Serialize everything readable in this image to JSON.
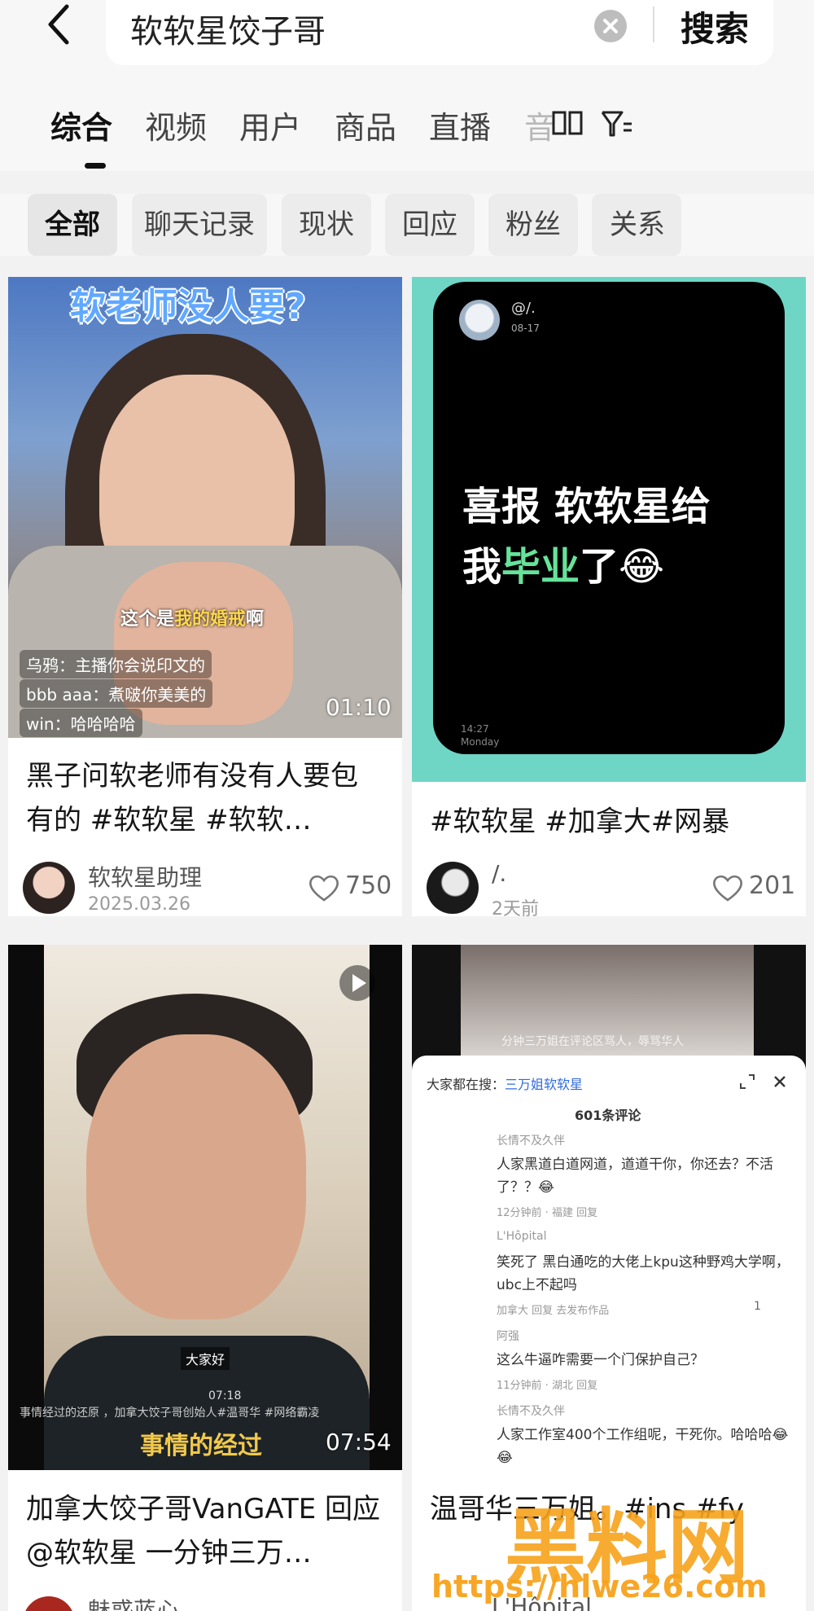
{
  "search": {
    "query": "软软星饺子哥",
    "button": "搜索"
  },
  "tabs": [
    {
      "label": "综合",
      "active": true
    },
    {
      "label": "视频",
      "active": false
    },
    {
      "label": "用户",
      "active": false
    },
    {
      "label": "商品",
      "active": false
    },
    {
      "label": "直播",
      "active": false
    },
    {
      "label": "音",
      "active": false
    }
  ],
  "chips": [
    {
      "label": "全部",
      "active": true
    },
    {
      "label": "聊天记录",
      "active": false
    },
    {
      "label": "现状",
      "active": false
    },
    {
      "label": "回应",
      "active": false
    },
    {
      "label": "粉丝",
      "active": false
    },
    {
      "label": "关系",
      "active": false
    }
  ],
  "cards": [
    {
      "thumb_caption": "软老师没人要?",
      "subtitle_white": "这个是",
      "subtitle_yellow": "我的婚戒",
      "subtitle_end": "啊",
      "chat": [
        "乌鸦：主播你会说印文的",
        "bbb aaa：煮啵你美美的",
        "win：哈哈哈哈"
      ],
      "duration": "01:10",
      "title": "黑子问软老师有没有人要包有的 #软软星 #软软…",
      "author": "软软星助理",
      "date": "2025.03.26",
      "likes": "750"
    },
    {
      "handle": "@/.",
      "post_date": "08-17",
      "headline_1": "喜报  软软星给",
      "headline_2a": "我",
      "headline_2b": "毕业",
      "headline_2c": "了😂",
      "time": "14:27",
      "day": "Monday",
      "title": "#软软星 #加拿大#网暴",
      "author": "/.",
      "date": "2天前",
      "likes": "201"
    },
    {
      "caption_small": "大家好",
      "caption_big": "事情的经过",
      "meta_line": "事情经过的还原 ，加拿大饺子哥创始人#温哥华 #网络霸凌",
      "time_small": "07:18",
      "duration": "07:54",
      "title": "加拿大饺子哥VanGATE 回应@软软星 一分钟三万…",
      "author": "魅惑蓝心"
    },
    {
      "blurred_sub": "分钟三万姐在评论区骂人，辱骂华人",
      "search_hint": "大家都在搜：",
      "search_hint_link": "三万姐软软星",
      "comment_count": "601条评论",
      "comments": [
        {
          "user": "长情不及久伴",
          "text": "人家黑道白道网道，道道干你，你还去？不活了？？😂",
          "meta": "12分钟前 · 福建   回复"
        },
        {
          "user": "L'Hôpital",
          "text": "笑死了 黑白通吃的大佬上kpu这种野鸡大学啊，ubc上不起吗",
          "meta": "加拿大   回复   去发布作品",
          "likes": "1"
        },
        {
          "user": "阿强",
          "text": "这么牛逼咋需要一个门保护自己？",
          "meta": "11分钟前 · 湖北   回复"
        },
        {
          "user": "长情不及久伴",
          "text": "人家工作室400个工作组呢，干死你。哈哈哈😂😂",
          "meta": ""
        }
      ],
      "title": "温哥华三万姐。#ins #fy",
      "author": "L'Hôpital"
    }
  ],
  "watermark": {
    "brand": "黑料网",
    "url": "https://hlwe26.com"
  },
  "colors": {
    "accent_green": "#66e39a",
    "caption_blue": "#60a8ff",
    "teal_bg": "#6fd6c6",
    "watermark_orange": "#f7a21b"
  }
}
